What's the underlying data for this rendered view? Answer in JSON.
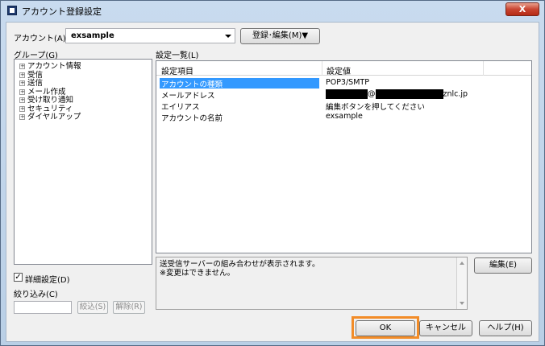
{
  "window": {
    "title": "アカウント登録設定",
    "close_label": "X"
  },
  "account": {
    "label": "アカウント(A)",
    "value": "exsample",
    "register_button": "登録･編集(M)▼"
  },
  "group": {
    "label": "グループ(G)",
    "items": [
      "アカウント情報",
      "受信",
      "送信",
      "メール作成",
      "受け取り通知",
      "セキュリティ",
      "ダイヤルアップ"
    ]
  },
  "settings": {
    "label": "設定一覧(L)",
    "headers": [
      "設定項目",
      "設定値"
    ],
    "rows": [
      {
        "item": "アカウントの種類",
        "value": "POP3/SMTP"
      },
      {
        "item": "メールアドレス",
        "value_mid": "@",
        "value_suffix": "znlc.jp"
      },
      {
        "item": "エイリアス",
        "value": "編集ボタンを押してください"
      },
      {
        "item": "アカウントの名前",
        "value": "exsample"
      }
    ]
  },
  "description": {
    "line1": "送受信サーバーの組み合わせが表示されます。",
    "line2": "※変更はできません。"
  },
  "edit_button": "編集(E)",
  "advanced": {
    "checkbox_label": "詳細設定(D)",
    "checked": true
  },
  "filter": {
    "label": "絞り込み(C)",
    "apply_button": "絞込(S)",
    "clear_button": "解除(R)"
  },
  "footer": {
    "ok": "OK",
    "cancel": "キャンセル",
    "help": "ヘルプ(H)"
  },
  "colors": {
    "selection": "#3399ff",
    "highlight": "#f28c28"
  }
}
